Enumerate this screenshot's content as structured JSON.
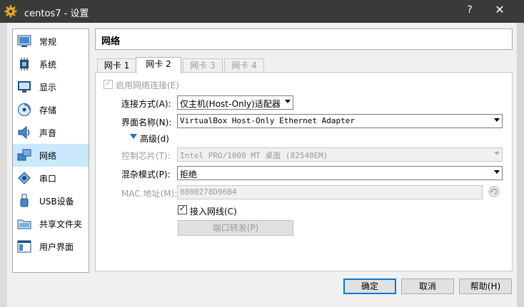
{
  "window": {
    "title": "centos7 - 设置",
    "help_label": "?",
    "close_label": "✕"
  },
  "sidebar": {
    "items": [
      {
        "label": "常规",
        "icon": "general-icon"
      },
      {
        "label": "系统",
        "icon": "system-icon"
      },
      {
        "label": "显示",
        "icon": "display-icon"
      },
      {
        "label": "存储",
        "icon": "storage-icon"
      },
      {
        "label": "声音",
        "icon": "audio-icon"
      },
      {
        "label": "网络",
        "icon": "network-icon",
        "selected": true
      },
      {
        "label": "串口",
        "icon": "serial-port-icon"
      },
      {
        "label": "USB设备",
        "icon": "usb-icon"
      },
      {
        "label": "共享文件夹",
        "icon": "shared-folder-icon"
      },
      {
        "label": "用户界面",
        "icon": "user-interface-icon"
      }
    ]
  },
  "header": {
    "title": "网络"
  },
  "tabs": [
    {
      "label": "网卡 1"
    },
    {
      "label": "网卡 2",
      "active": true
    },
    {
      "label": "网卡 3",
      "disabled": true
    },
    {
      "label": "网卡 4",
      "disabled": true
    }
  ],
  "form": {
    "enable_label": "启用网络连接(E)",
    "enable_checked": true,
    "attached_label": "连接方式(A):",
    "attached_value": "仅主机(Host-Only)适配器",
    "name_label": "界面名称(N):",
    "name_value": "VirtualBox Host-Only Ethernet Adapter",
    "advanced_label": "高级(d)",
    "chip_label": "控制芯片(T):",
    "chip_value": "Intel PRO/1000 MT 桌面 (82540EM)",
    "promisc_label": "混杂模式(P):",
    "promisc_value": "拒绝",
    "mac_label": "MAC 地址(M):",
    "mac_value": "0800278D96B4",
    "cable_label": "接入网线(C)",
    "cable_checked": true,
    "port_forward_label": "端口转发(P)"
  },
  "buttons": {
    "ok": "确定",
    "cancel": "取消",
    "help": "帮助(H)"
  },
  "colors": {
    "titlebar": "#3a3a3a",
    "selection": "#cce8ff",
    "accent": "#0078d7"
  }
}
